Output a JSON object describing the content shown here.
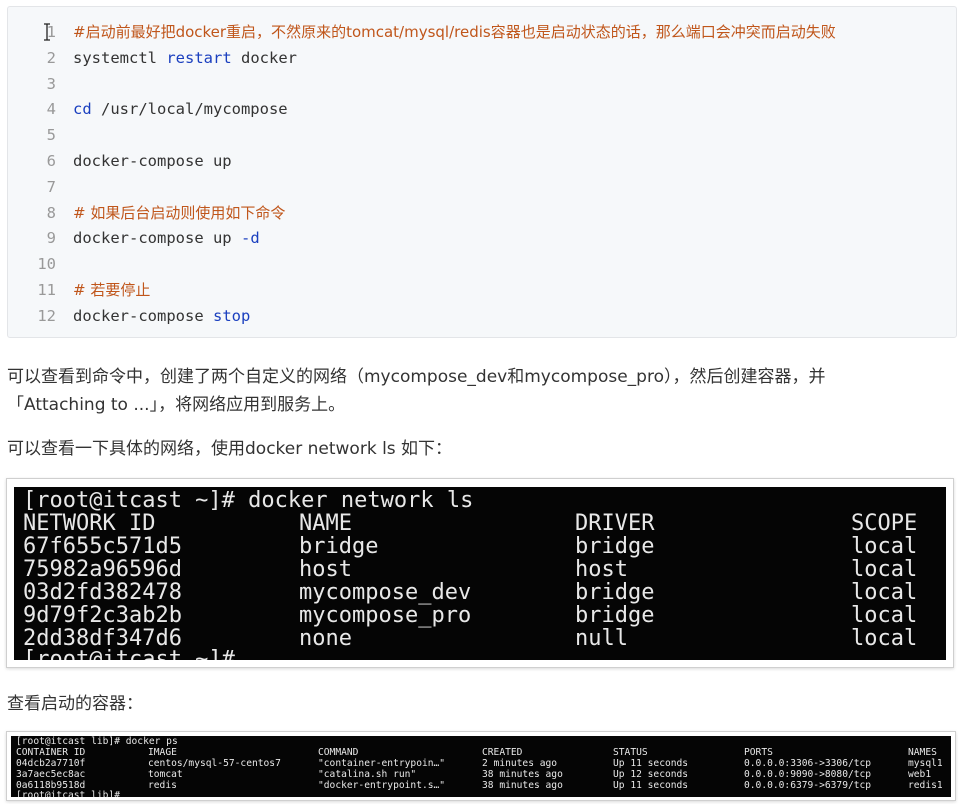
{
  "code_block": {
    "lines": [
      {
        "num": "1",
        "text": "#启动前最好把docker重启，不然原来的tomcat/mysql/redis容器也是启动状态的话，那么端口会冲突而启动失败"
      },
      {
        "num": "2",
        "pre": "systemctl ",
        "kw": "restart",
        "post": " docker"
      },
      {
        "num": "3",
        "text": ""
      },
      {
        "num": "4",
        "kw": "cd",
        "post": " /usr/local/mycompose"
      },
      {
        "num": "5",
        "text": ""
      },
      {
        "num": "6",
        "text": "docker-compose up"
      },
      {
        "num": "7",
        "text": ""
      },
      {
        "num": "8",
        "text": "# 如果后台启动则使用如下命令"
      },
      {
        "num": "9",
        "pre": "docker-compose up ",
        "kw": "-d"
      },
      {
        "num": "10",
        "text": ""
      },
      {
        "num": "11",
        "text": "# 若要停止"
      },
      {
        "num": "12",
        "pre": "docker-compose ",
        "kw": "stop"
      }
    ]
  },
  "paragraphs": {
    "p1_line1": "可以查看到命令中，创建了两个自定义的网络（mycompose_dev和mycompose_pro），然后创建容器，并",
    "p1_line2": "「Attaching to ...」，将网络应用到服务上。",
    "p2": "可以查看一下具体的网络，使用docker network ls 如下：",
    "p3": "查看启动的容器："
  },
  "network_terminal": {
    "prompt": "[root@itcast ~]# docker network ls",
    "headers": [
      "NETWORK ID",
      "NAME",
      "DRIVER",
      "SCOPE"
    ],
    "rows": [
      [
        "67f655c571d5",
        "bridge",
        "bridge",
        "local"
      ],
      [
        "75982a96596d",
        "host",
        "host",
        "local"
      ],
      [
        "03d2fd382478",
        "mycompose_dev",
        "bridge",
        "local"
      ],
      [
        "9d79f2c3ab2b",
        "mycompose_pro",
        "bridge",
        "local"
      ],
      [
        "2dd38df347d6",
        "none",
        "null",
        "local"
      ]
    ],
    "trailing_prompt": "[root@itcast ~]#"
  },
  "ps_terminal": {
    "prompt": "[root@itcast lib]# docker ps",
    "headers": [
      "CONTAINER ID",
      "IMAGE",
      "COMMAND",
      "CREATED",
      "STATUS",
      "PORTS",
      "NAMES"
    ],
    "rows": [
      [
        "04dcb2a7710f",
        "centos/mysql-57-centos7",
        "\"container-entrypoin…\"",
        "2 minutes ago",
        "Up 11 seconds",
        "0.0.0.0:3306->3306/tcp",
        "mysql1"
      ],
      [
        "3a7aec5ec8ac",
        "tomcat",
        "\"catalina.sh run\"",
        "38 minutes ago",
        "Up 12 seconds",
        "0.0.0.0:9090->8080/tcp",
        "web1"
      ],
      [
        "0a6118b9518d",
        "redis",
        "\"docker-entrypoint.s…\"",
        "38 minutes ago",
        "Up 11 seconds",
        "0.0.0.0:6379->6379/tcp",
        "redis1"
      ]
    ],
    "trailing_prompt": "[root@itcast lib]#"
  },
  "colors": {
    "comment": "#c0561b",
    "keyword": "#1a3fbf",
    "terminal_bg": "#050505",
    "terminal_fg": "#e8e8e8"
  }
}
